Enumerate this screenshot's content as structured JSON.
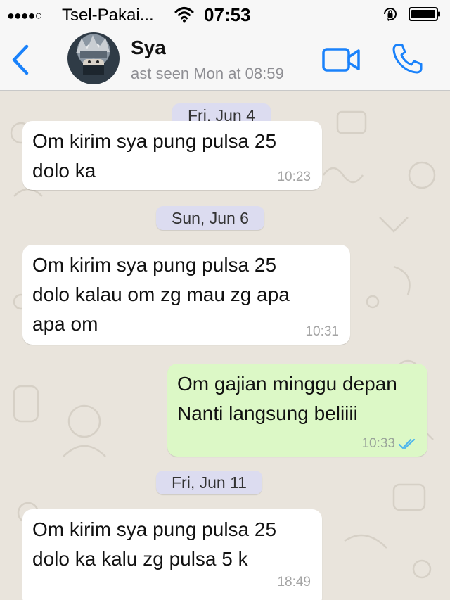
{
  "status": {
    "signal": "●●●●○",
    "carrier": "Tsel-Pakai...",
    "time": "07:53"
  },
  "header": {
    "name": "Sya",
    "last_seen": "ast seen Mon at 08:59"
  },
  "messages": [
    {
      "kind": "date",
      "text": "Fri, Jun 4"
    },
    {
      "kind": "in",
      "text": "Om kirim sya pung pulsa 25\ndolo ka",
      "time": "10:23"
    },
    {
      "kind": "date",
      "text": "Sun, Jun 6"
    },
    {
      "kind": "in",
      "text": "Om kirim sya pung pulsa 25\ndolo kalau om zg mau zg apa\napa om",
      "time": "10:31"
    },
    {
      "kind": "out",
      "text": "Om gajian minggu depan\nNanti langsung beliiii",
      "time": "10:33",
      "status": "read"
    },
    {
      "kind": "date",
      "text": "Fri, Jun 11"
    },
    {
      "kind": "in",
      "text": "Om kirim sya pung pulsa 25\ndolo ka kalu zg pulsa 5 k",
      "time": "18:49"
    }
  ],
  "colors": {
    "accent": "#1a82fb",
    "incoming": "#ffffff",
    "outgoing": "#dcf8c6",
    "date_pill": "#dcdcf0",
    "chat_background": "#e9e4dc",
    "read_ticks": "#4fb6ec"
  },
  "icons": {
    "back": "chevron-left-icon",
    "video": "video-camera-icon",
    "call": "phone-icon",
    "wifi": "wifi-icon",
    "lock": "orientation-lock-icon",
    "battery": "battery-icon",
    "read": "double-check-icon"
  }
}
